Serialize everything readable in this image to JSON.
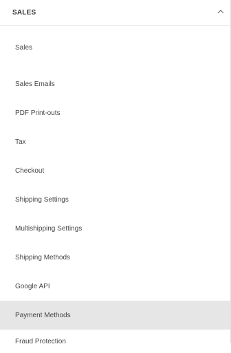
{
  "section": {
    "title": "SALES",
    "chevron_icon": "chevron-up-icon"
  },
  "items": [
    {
      "label": "Sales"
    },
    {
      "label": "Sales Emails"
    },
    {
      "label": "PDF Print-outs"
    },
    {
      "label": "Tax"
    },
    {
      "label": "Checkout"
    },
    {
      "label": "Shipping Settings"
    },
    {
      "label": "Multishipping Settings"
    },
    {
      "label": "Shipping Methods"
    },
    {
      "label": "Google API"
    },
    {
      "label": "Payment Methods",
      "active": true
    },
    {
      "label": "Fraud Protection"
    }
  ],
  "colors": {
    "active_background": "#e6e6e6",
    "divider": "#e3e3e3"
  }
}
